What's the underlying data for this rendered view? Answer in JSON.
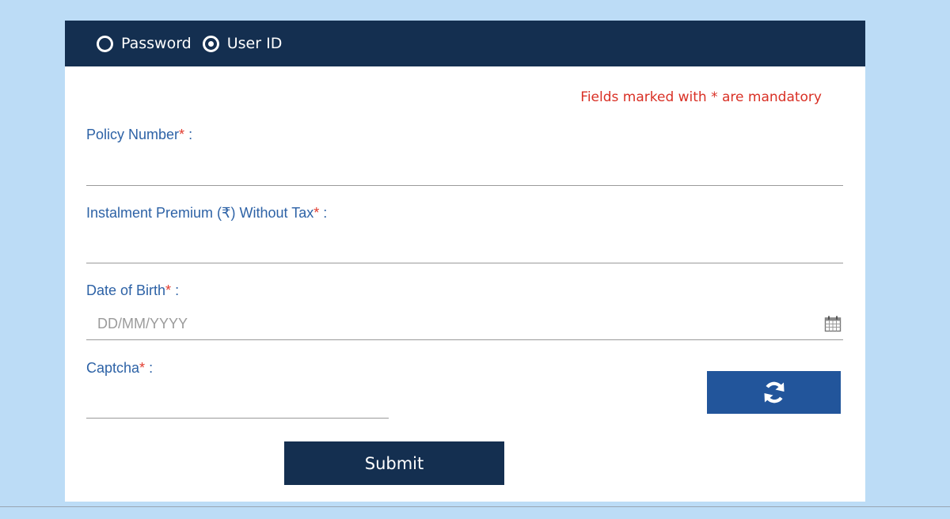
{
  "login_mode": {
    "options": [
      {
        "label": "Password",
        "selected": false
      },
      {
        "label": "User ID",
        "selected": true
      }
    ]
  },
  "form": {
    "mandatory_note": "Fields marked with * are mandatory",
    "required_marker": "*",
    "label_suffix": " :",
    "policy_number": {
      "label": "Policy Number",
      "value": "",
      "placeholder": ""
    },
    "instalment_premium": {
      "label": "Instalment Premium (₹) Without Tax",
      "value": "",
      "placeholder": ""
    },
    "date_of_birth": {
      "label": "Date of Birth",
      "value": "",
      "placeholder": "DD/MM/YYYY",
      "icon": "calendar-icon"
    },
    "captcha": {
      "label": "Captcha",
      "value": "",
      "placeholder": "",
      "refresh_icon": "refresh-icon"
    },
    "submit_label": "Submit"
  },
  "colors": {
    "header_bg": "#142f50",
    "page_bg": "#bcdcf6",
    "label_blue": "#2d62a6",
    "required_red": "#e23b2e",
    "refresh_button": "#22559b"
  }
}
